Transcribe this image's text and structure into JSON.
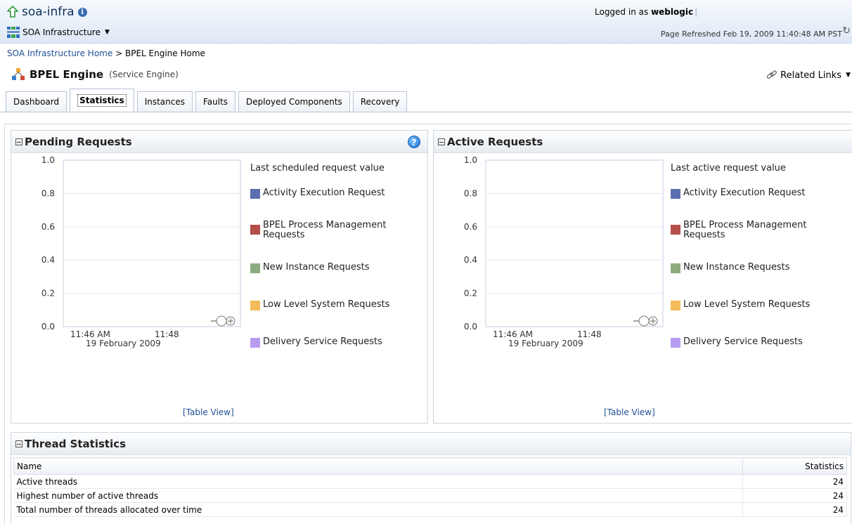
{
  "header": {
    "app_title": "soa-infra",
    "menu_label": "SOA Infrastructure",
    "logged_in_prefix": "Logged in as",
    "username": "weblogic",
    "page_refreshed": "Page Refreshed Feb 19, 2009 11:40:48 AM PST"
  },
  "breadcrumb": {
    "home_link": "SOA Infrastructure Home",
    "separator": ">",
    "current": "BPEL Engine Home"
  },
  "page": {
    "title": "BPEL Engine",
    "subtitle": "(Service Engine)",
    "related_links": "Related Links"
  },
  "tabs": [
    {
      "label": "Dashboard",
      "active": false
    },
    {
      "label": "Statistics",
      "active": true
    },
    {
      "label": "Instances",
      "active": false
    },
    {
      "label": "Faults",
      "active": false
    },
    {
      "label": "Deployed Components",
      "active": false
    },
    {
      "label": "Recovery",
      "active": false
    }
  ],
  "pending": {
    "title": "Pending Requests",
    "legend_title": "Last scheduled request value",
    "table_view": "[Table View]"
  },
  "active": {
    "title": "Active Requests",
    "legend_title": "Last active request value",
    "table_view": "[Table View]"
  },
  "legend_items": [
    {
      "label": "Activity Execution Request",
      "color": "#5b6fb0"
    },
    {
      "label": "BPEL Process Management Requests",
      "color": "#b34e4a"
    },
    {
      "label": "New Instance Requests",
      "color": "#8cac80"
    },
    {
      "label": "Low Level System Requests",
      "color": "#f3bb5b"
    },
    {
      "label": "Delivery Service Requests",
      "color": "#b89cf0"
    }
  ],
  "chart_data": [
    {
      "type": "line",
      "ylim": [
        0.0,
        1.0
      ],
      "y_ticks": [
        "1.0",
        "0.8",
        "0.6",
        "0.4",
        "0.2",
        "0.0"
      ],
      "x_ticks": [
        "11:46 AM",
        "11:48"
      ],
      "x_date": "19 February 2009",
      "series": []
    },
    {
      "type": "line",
      "ylim": [
        0.0,
        1.0
      ],
      "y_ticks": [
        "1.0",
        "0.8",
        "0.6",
        "0.4",
        "0.2",
        "0.0"
      ],
      "x_ticks": [
        "11:46 AM",
        "11:48"
      ],
      "x_date": "19 February 2009",
      "series": []
    }
  ],
  "thread_stats": {
    "title": "Thread Statistics",
    "columns": [
      "Name",
      "Statistics"
    ],
    "rows": [
      {
        "name": "Active threads",
        "value": "24"
      },
      {
        "name": "Highest number of active threads",
        "value": "24"
      },
      {
        "name": "Total number of threads allocated over time",
        "value": "24"
      }
    ]
  }
}
